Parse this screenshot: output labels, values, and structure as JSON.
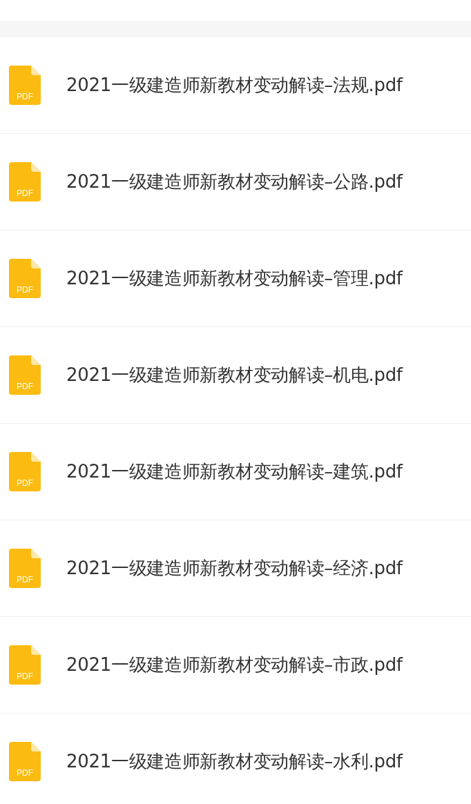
{
  "files": [
    {
      "icon_label": "PDF",
      "name": "2021一级建造师新教材变动解读–法规.pdf"
    },
    {
      "icon_label": "PDF",
      "name": "2021一级建造师新教材变动解读–公路.pdf"
    },
    {
      "icon_label": "PDF",
      "name": "2021一级建造师新教材变动解读–管理.pdf"
    },
    {
      "icon_label": "PDF",
      "name": "2021一级建造师新教材变动解读–机电.pdf"
    },
    {
      "icon_label": "PDF",
      "name": "2021一级建造师新教材变动解读–建筑.pdf"
    },
    {
      "icon_label": "PDF",
      "name": "2021一级建造师新教材变动解读–经济.pdf"
    },
    {
      "icon_label": "PDF",
      "name": "2021一级建造师新教材变动解读–市政.pdf"
    },
    {
      "icon_label": "PDF",
      "name": "2021一级建造师新教材变动解读–水利.pdf"
    }
  ]
}
